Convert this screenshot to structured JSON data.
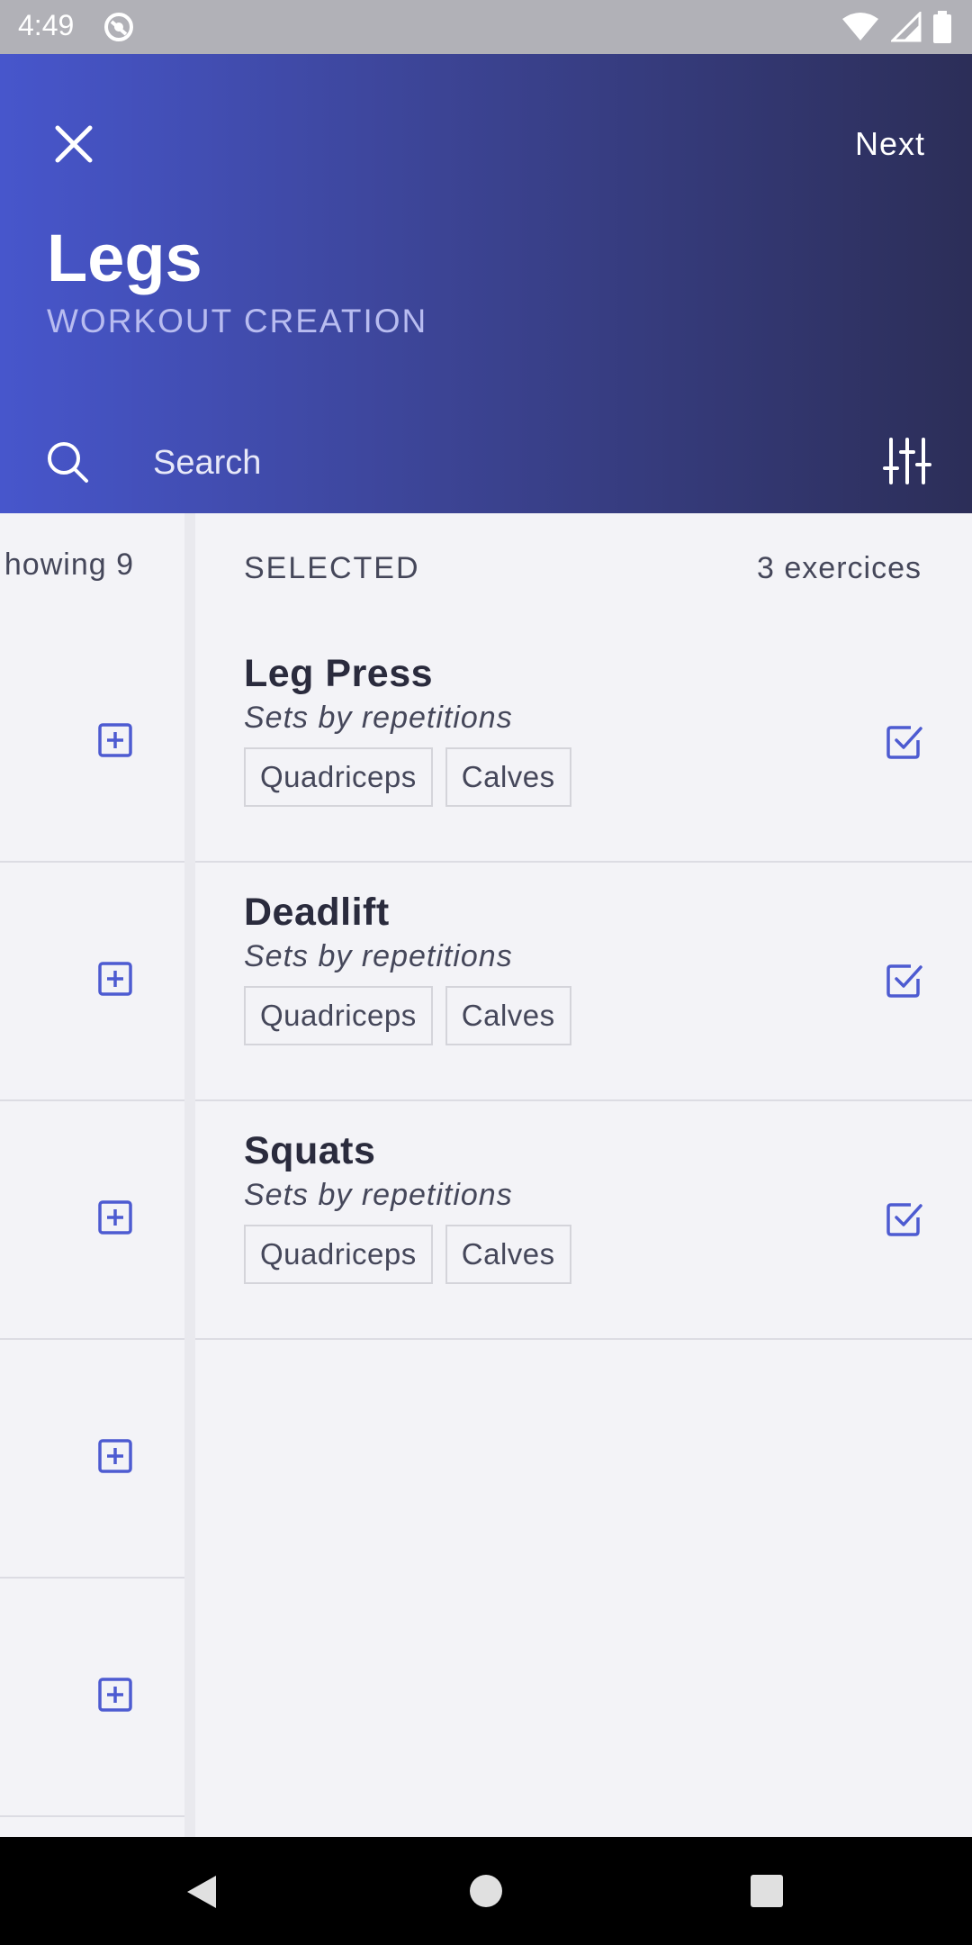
{
  "status_bar": {
    "time": "4:49",
    "icons": [
      "app-notification-icon",
      "wifi-icon",
      "cell-signal-icon",
      "battery-icon"
    ]
  },
  "header": {
    "title": "Legs",
    "subtitle": "WORKOUT CREATION",
    "next_label": "Next",
    "close_icon": "close-icon",
    "gradient_colors": [
      "#4756cc",
      "#2c2e58"
    ]
  },
  "search": {
    "placeholder": "Search",
    "icon": "search-icon",
    "filter_icon": "filter-sliders-icon"
  },
  "available": {
    "showing_text": "howing 9",
    "row_icon": "add-box-icon"
  },
  "selected": {
    "label": "SELECTED",
    "count": "3 exercices",
    "exercises": [
      {
        "name": "Leg Press",
        "type": "Sets by repetitions",
        "tags": [
          "Quadriceps",
          "Calves"
        ]
      },
      {
        "name": "Deadlift",
        "type": "Sets by repetitions",
        "tags": [
          "Quadriceps",
          "Calves"
        ]
      },
      {
        "name": "Squats",
        "type": "Sets by repetitions",
        "tags": [
          "Quadriceps",
          "Calves"
        ]
      }
    ],
    "row_icon": "checkbox-checked-icon"
  },
  "colors": {
    "accent": "#4d5bd1",
    "background": "#f3f3f7",
    "text_dark": "#2a2b3d",
    "text_muted": "#45475a"
  },
  "nav_bar": {
    "icons": [
      "back-icon",
      "home-icon",
      "recents-icon"
    ]
  }
}
